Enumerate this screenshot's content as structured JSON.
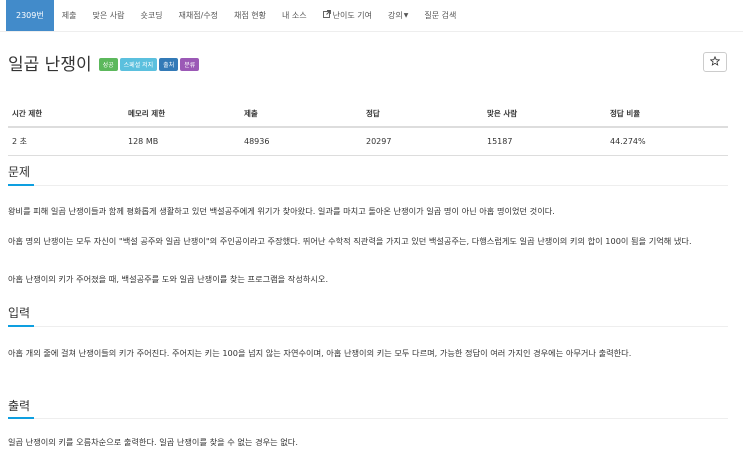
{
  "nav": {
    "tabs": [
      {
        "label": "2309번",
        "active": true
      },
      {
        "label": "제출"
      },
      {
        "label": "맞은 사람"
      },
      {
        "label": "숏코딩"
      },
      {
        "label": "재채점/수정"
      },
      {
        "label": "채점 현황"
      },
      {
        "label": "내 소스"
      },
      {
        "label": "난이도 기여",
        "icon": "external-link-icon"
      },
      {
        "label": "강의",
        "icon": "caret-down-icon"
      },
      {
        "label": "질문 검색"
      }
    ]
  },
  "problem": {
    "title": "일곱 난쟁이",
    "badges": [
      {
        "label": "성공",
        "color": "#5cb85c"
      },
      {
        "label": "스페셜 저지",
        "color": "#5bc0de"
      },
      {
        "label": "출처",
        "color": "#337ab7"
      },
      {
        "label": "분류",
        "color": "#9b59b6"
      }
    ],
    "star_icon": "star-icon"
  },
  "info_table": {
    "headers": [
      "시간 제한",
      "메모리 제한",
      "제출",
      "정답",
      "맞은 사람",
      "정답 비율"
    ],
    "values": [
      "2 초",
      "128 MB",
      "48936",
      "20297",
      "15187",
      "44.274%"
    ]
  },
  "sections": {
    "problem_heading": "문제",
    "problem_p1": "왕비를 피해 일곱 난쟁이들과 함께 평화롭게 생활하고 있던 백설공주에게 위기가 찾아왔다. 일과를 마치고 돌아온 난쟁이가 일곱 명이 아닌 아홉 명이었던 것이다.",
    "problem_p2": "아홉 명의 난쟁이는 모두 자신이 \"백설 공주와 일곱 난쟁이\"의 주인공이라고 주장했다. 뛰어난 수학적 직관력을 가지고 있던 백설공주는, 다행스럽게도 일곱 난쟁이의 키의 합이 100이 됨을 기억해 냈다.",
    "problem_p3": "아홉 난쟁이의 키가 주어졌을 때, 백설공주를 도와 일곱 난쟁이를 찾는 프로그램을 작성하시오.",
    "input_heading": "입력",
    "input_p1": "아홉 개의 줄에 걸쳐 난쟁이들의 키가 주어진다. 주어지는 키는 100을 넘지 않는 자연수이며, 아홉 난쟁이의 키는 모두 다르며, 가능한 정답이 여러 가지인 경우에는 아무거나 출력한다.",
    "output_heading": "출력",
    "output_p1": "일곱 난쟁이의 키를 오름차순으로 출력한다. 일곱 난쟁이를 찾을 수 없는 경우는 없다."
  }
}
